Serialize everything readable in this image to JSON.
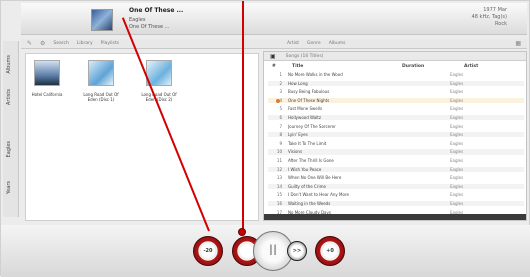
{
  "now_playing": {
    "title": "One Of These ...",
    "artist": "Eagles",
    "album": "One Of These ..."
  },
  "track_info": [
    "1977 Mar",
    "48 kHz, Tag(s)",
    "Rock"
  ],
  "toolbar": [
    "Search",
    "Library",
    "Playlists",
    "Artist",
    "Genre",
    "Albums"
  ],
  "left_nav": [
    "Albums",
    "Artists",
    "Eagles",
    "Years"
  ],
  "albums": [
    {
      "caption": "Hotel California"
    },
    {
      "caption": "Long Road Out Of Eden (Disc 1)"
    },
    {
      "caption": "Long Road Out Of Eden (Disc 2)"
    }
  ],
  "playlist": {
    "tab": "Songs (16 Titles)",
    "columns": {
      "number": "#",
      "title": "Title",
      "duration": "Duration",
      "artist": "Artist"
    },
    "rows": [
      {
        "n": "1",
        "t": "No More Walks in the Wood",
        "a": "Eagles"
      },
      {
        "n": "2",
        "t": "How Long",
        "a": "Eagles"
      },
      {
        "n": "3",
        "t": "Busy Being Fabulous",
        "a": "Eagles"
      },
      {
        "n": "4",
        "t": "One Of These Nights",
        "a": "Eagles"
      },
      {
        "n": "5",
        "t": "Fast Mone Swells",
        "a": "Eagles"
      },
      {
        "n": "6",
        "t": "Hollywood Waltz",
        "a": "Eagles"
      },
      {
        "n": "7",
        "t": "Journey Of The Sorcerer",
        "a": "Eagles"
      },
      {
        "n": "8",
        "t": "Lyin' Eyes",
        "a": "Eagles"
      },
      {
        "n": "9",
        "t": "Take It To The Limit",
        "a": "Eagles"
      },
      {
        "n": "10",
        "t": "Visions",
        "a": "Eagles"
      },
      {
        "n": "11",
        "t": "After The Thrill Is Gone",
        "a": "Eagles"
      },
      {
        "n": "12",
        "t": "I Wish You Peace",
        "a": "Eagles"
      },
      {
        "n": "13",
        "t": "When No One Will Be Here",
        "a": "Eagles"
      },
      {
        "n": "14",
        "t": "Guilty of the Crime",
        "a": "Eagles"
      },
      {
        "n": "15",
        "t": "I Don't Want to Hear Any More",
        "a": "Eagles"
      },
      {
        "n": "16",
        "t": "Waiting in the Weeds",
        "a": "Eagles"
      },
      {
        "n": "17",
        "t": "No More Cloudy Days",
        "a": "Eagles"
      }
    ]
  },
  "controls": {
    "vol_down": "-20",
    "prev": "",
    "pause": "II",
    "next": ">>",
    "vol_up": "+0"
  },
  "colors": {
    "accent_red": "#b11616",
    "highlight": "#e07a2c"
  }
}
